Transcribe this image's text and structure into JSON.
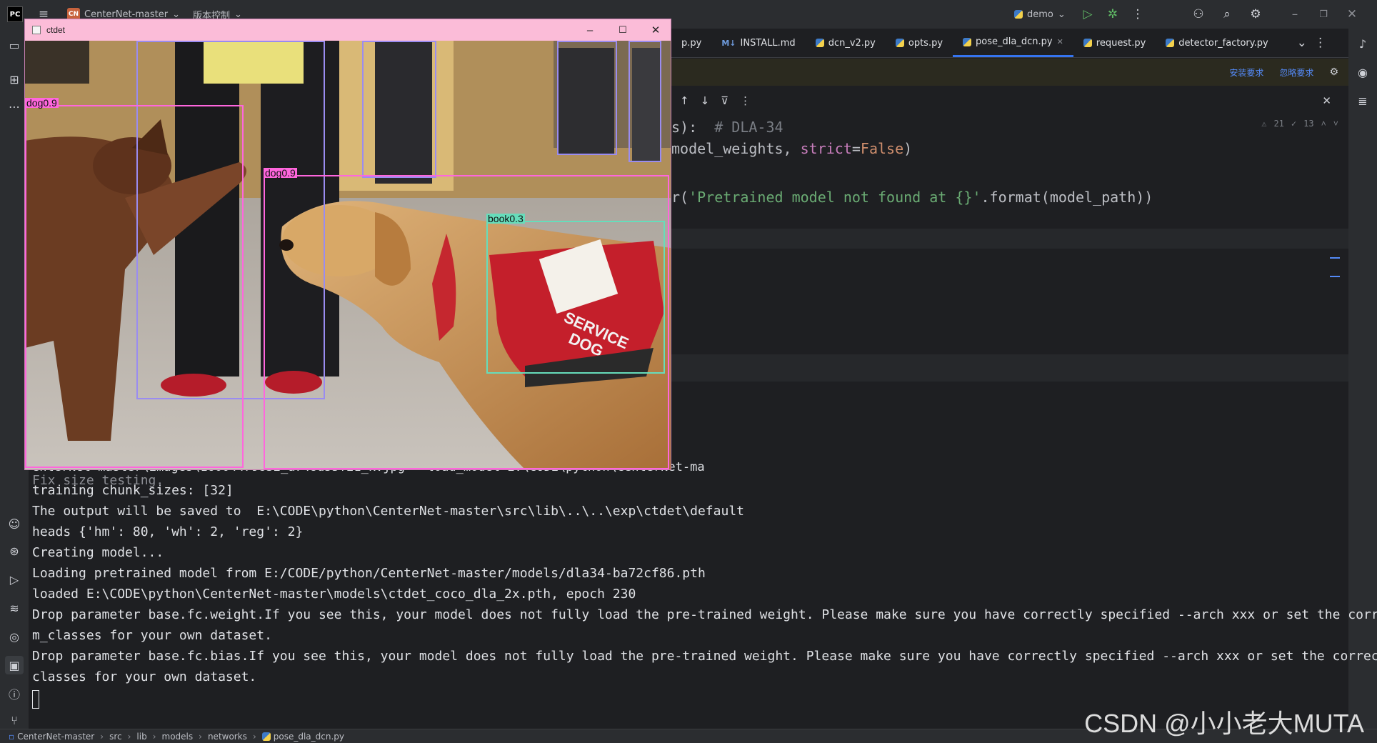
{
  "ide": {
    "project_badge": "CN",
    "project_name": "CenterNet-master",
    "vcs_label": "版本控制",
    "run_config": "demo",
    "tabs": [
      {
        "label": "p.py",
        "icon": "python-file-icon"
      },
      {
        "label": "INSTALL.md",
        "icon": "markdown-file-icon",
        "prefix": "M↓"
      },
      {
        "label": "dcn_v2.py",
        "icon": "python-file-icon"
      },
      {
        "label": "opts.py",
        "icon": "python-file-icon"
      },
      {
        "label": "pose_dla_dcn.py",
        "icon": "python-file-icon",
        "active": true
      },
      {
        "label": "request.py",
        "icon": "python-file-icon"
      },
      {
        "label": "detector_factory.py",
        "icon": "python-file-icon"
      }
    ],
    "notice": {
      "install_link": "安装要求",
      "ignore_link": "忽略要求"
    },
    "inspections": {
      "warnings": "21",
      "weak": "13"
    }
  },
  "editor": {
    "line1_code": "s):  ",
    "line1_comment": "# DLA-34",
    "line2_a": "model_weights, ",
    "line2_param": "strict",
    "line2_eq": "=",
    "line2_kw": "False",
    "line2_end": ")",
    "line3_a": "r(",
    "line3_str": "'Pretrained model not found at {}'",
    "line3_end": ".format(model_path))",
    "cmd_tail": "enterNet-master\\images\\16004479832_a748d55f21_k.jpg --load_model E:\\CODE\\python\\CenterNet-ma"
  },
  "terminal": {
    "lines": [
      "Fix size testing.",
      "training chunk_sizes: [32]",
      "The output will be saved to  E:\\CODE\\python\\CenterNet-master\\src\\lib\\..\\..\\exp\\ctdet\\default",
      "heads {'hm': 80, 'wh': 2, 'reg': 2}",
      "Creating model...",
      "Loading pretrained model from E:/CODE/python/CenterNet-master/models/dla34-ba72cf86.pth",
      "loaded E:\\CODE\\python\\CenterNet-master\\models\\ctdet_coco_dla_2x.pth, epoch 230",
      "Drop parameter base.fc.weight.If you see this, your model does not fully load the pre-trained weight. Please make sure you have correctly specified --arch xxx or set the correct --nu",
      "m_classes for your own dataset.",
      "Drop parameter base.fc.bias.If you see this, your model does not fully load the pre-trained weight. Please make sure you have correctly specified --arch xxx or set the correct --num_",
      "classes for your own dataset."
    ]
  },
  "statusbar": {
    "crumbs": [
      "CenterNet-master",
      "src",
      "lib",
      "models",
      "networks",
      "pose_dla_dcn.py"
    ]
  },
  "watermark": "CSDN @小小老大MUTA",
  "ctdet_window": {
    "title": "ctdet",
    "detections": [
      {
        "label": "dog0.9",
        "color": "#ff66dd"
      },
      {
        "label": "dog0.9",
        "color": "#ff66dd"
      },
      {
        "label": "book0.3",
        "color": "#66ddbb"
      },
      {
        "label": "",
        "color": "#9a8cf0"
      },
      {
        "label": "",
        "color": "#9a8cf0"
      },
      {
        "label": "",
        "color": "#9a8cf0"
      },
      {
        "label": "",
        "color": "#9a8cf0"
      }
    ],
    "vest_text_1": "SERVICE",
    "vest_text_2": "DOG"
  },
  "colors": {
    "ide_bg": "#1e1f22",
    "chrome": "#2b2d30",
    "accent": "#3574f0",
    "window_title": "#fbbcd8"
  }
}
